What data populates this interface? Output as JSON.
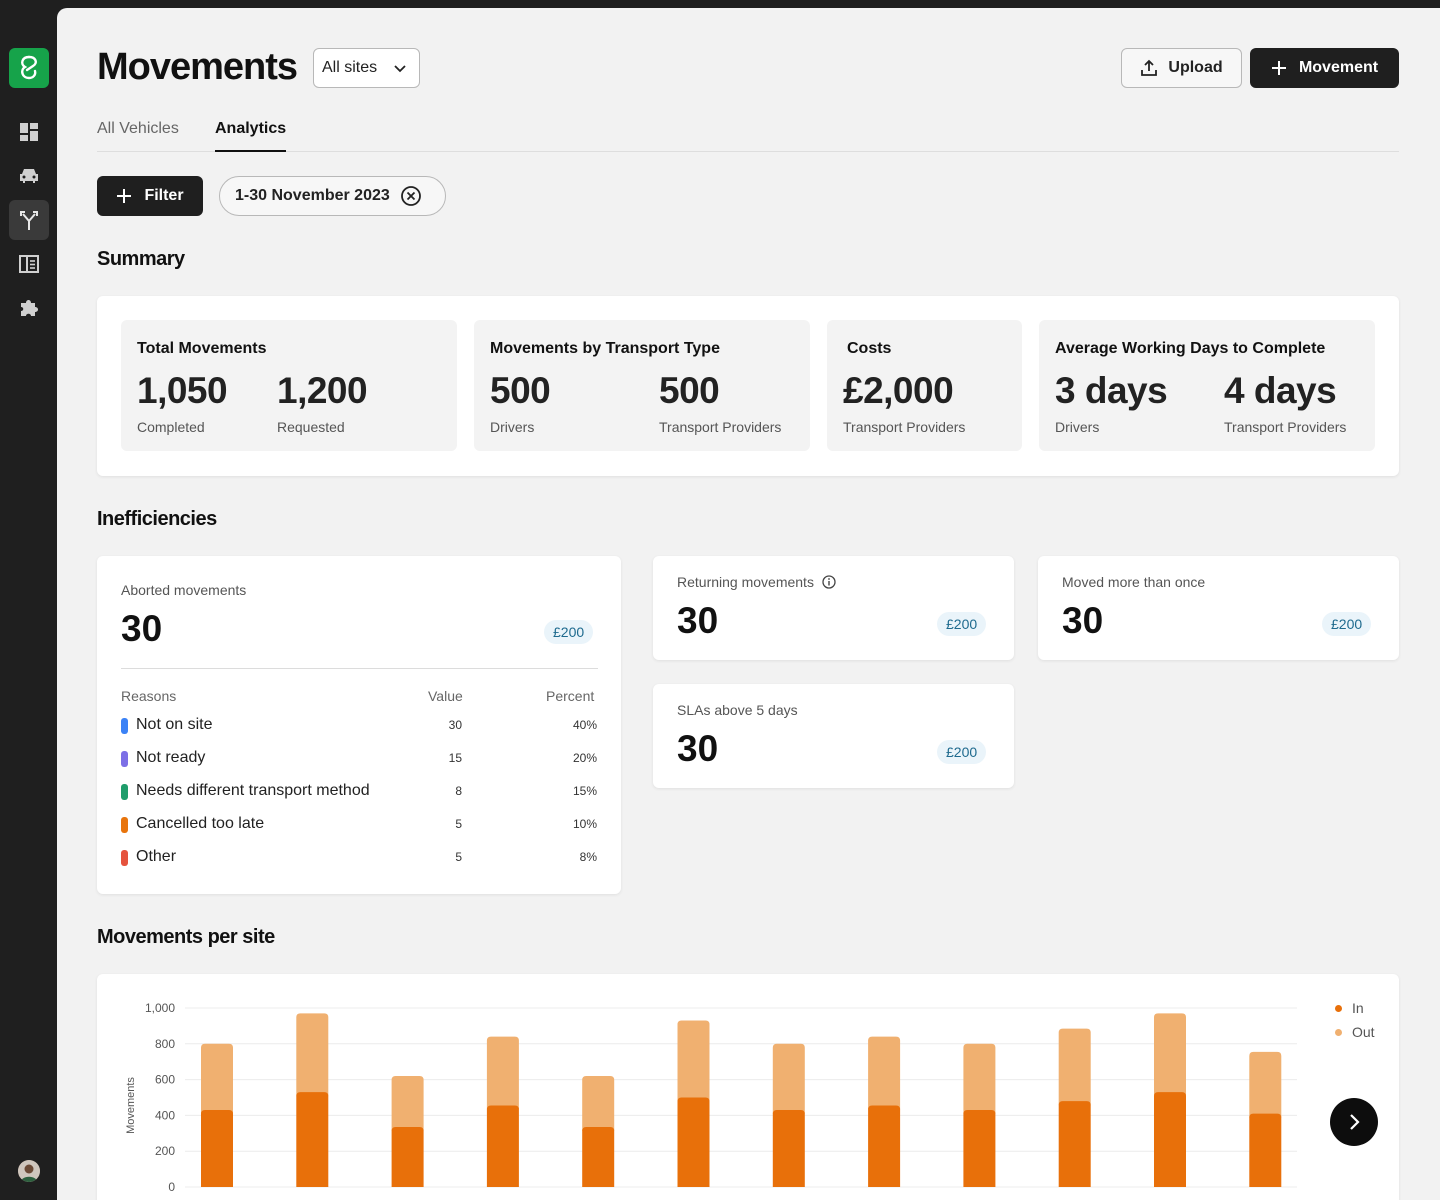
{
  "sidebar": {
    "items": [
      {
        "icon": "dashboard-icon",
        "active": false
      },
      {
        "icon": "car-icon",
        "active": false
      },
      {
        "icon": "fork-icon",
        "active": true
      },
      {
        "icon": "document-icon",
        "active": false
      },
      {
        "icon": "puzzle-icon",
        "active": false
      }
    ]
  },
  "header": {
    "title": "Movements",
    "site_select": "All sites",
    "upload_label": "Upload",
    "movement_label": "Movement"
  },
  "tabs": [
    {
      "label": "All Vehicles",
      "active": false
    },
    {
      "label": "Analytics",
      "active": true
    }
  ],
  "filters": {
    "filter_label": "Filter",
    "date_chip": "1-30 November 2023"
  },
  "summary": {
    "title": "Summary",
    "tiles": [
      {
        "title": "Total Movements",
        "metrics": [
          {
            "value": "1,050",
            "label": "Completed"
          },
          {
            "value": "1,200",
            "label": "Requested"
          }
        ]
      },
      {
        "title": "Movements by Transport Type",
        "metrics": [
          {
            "value": "500",
            "label": "Drivers"
          },
          {
            "value": "500",
            "label": "Transport Providers"
          }
        ]
      },
      {
        "title": "Costs",
        "metrics": [
          {
            "value": "£2,000",
            "label": "Transport Providers"
          }
        ]
      },
      {
        "title": "Average Working Days to Complete",
        "metrics": [
          {
            "value": "3 days",
            "label": "Drivers"
          },
          {
            "value": "4 days",
            "label": "Transport Providers"
          }
        ]
      }
    ]
  },
  "inefficiencies": {
    "title": "Inefficiencies",
    "aborted": {
      "label": "Aborted movements",
      "value": "30",
      "cost": "£200",
      "columns": {
        "reasons": "Reasons",
        "value": "Value",
        "percent": "Percent"
      },
      "reasons": [
        {
          "name": "Not on site",
          "value": "30",
          "percent": "40%",
          "color": "#3b82f6"
        },
        {
          "name": "Not ready",
          "value": "15",
          "percent": "20%",
          "color": "#7c6fe6"
        },
        {
          "name": "Needs different transport method",
          "value": "8",
          "percent": "15%",
          "color": "#1f9d6b"
        },
        {
          "name": "Cancelled too late",
          "value": "5",
          "percent": "10%",
          "color": "#e8740c"
        },
        {
          "name": "Other",
          "value": "5",
          "percent": "8%",
          "color": "#e5533d"
        }
      ]
    },
    "returning": {
      "label": "Returning movements",
      "value": "30",
      "cost": "£200"
    },
    "moved_more": {
      "label": "Moved more than once",
      "value": "30",
      "cost": "£200"
    },
    "slas": {
      "label": "SLAs above 5 days",
      "value": "30",
      "cost": "£200"
    }
  },
  "per_site": {
    "title": "Movements per site"
  },
  "chart_data": {
    "type": "bar",
    "stacked": true,
    "ylabel": "Movements",
    "ylim": [
      0,
      1000
    ],
    "yticks": [
      "0",
      "200",
      "400",
      "600",
      "800",
      "1,000"
    ],
    "grid": true,
    "legend_position": "top-right",
    "series": [
      {
        "name": "In",
        "color": "#e8700a",
        "values": [
          430,
          530,
          335,
          455,
          335,
          500,
          430,
          455,
          430,
          480,
          530,
          410
        ]
      },
      {
        "name": "Out",
        "color": "#f0b070",
        "values": [
          370,
          440,
          285,
          385,
          285,
          430,
          370,
          385,
          370,
          405,
          440,
          345
        ]
      }
    ]
  }
}
